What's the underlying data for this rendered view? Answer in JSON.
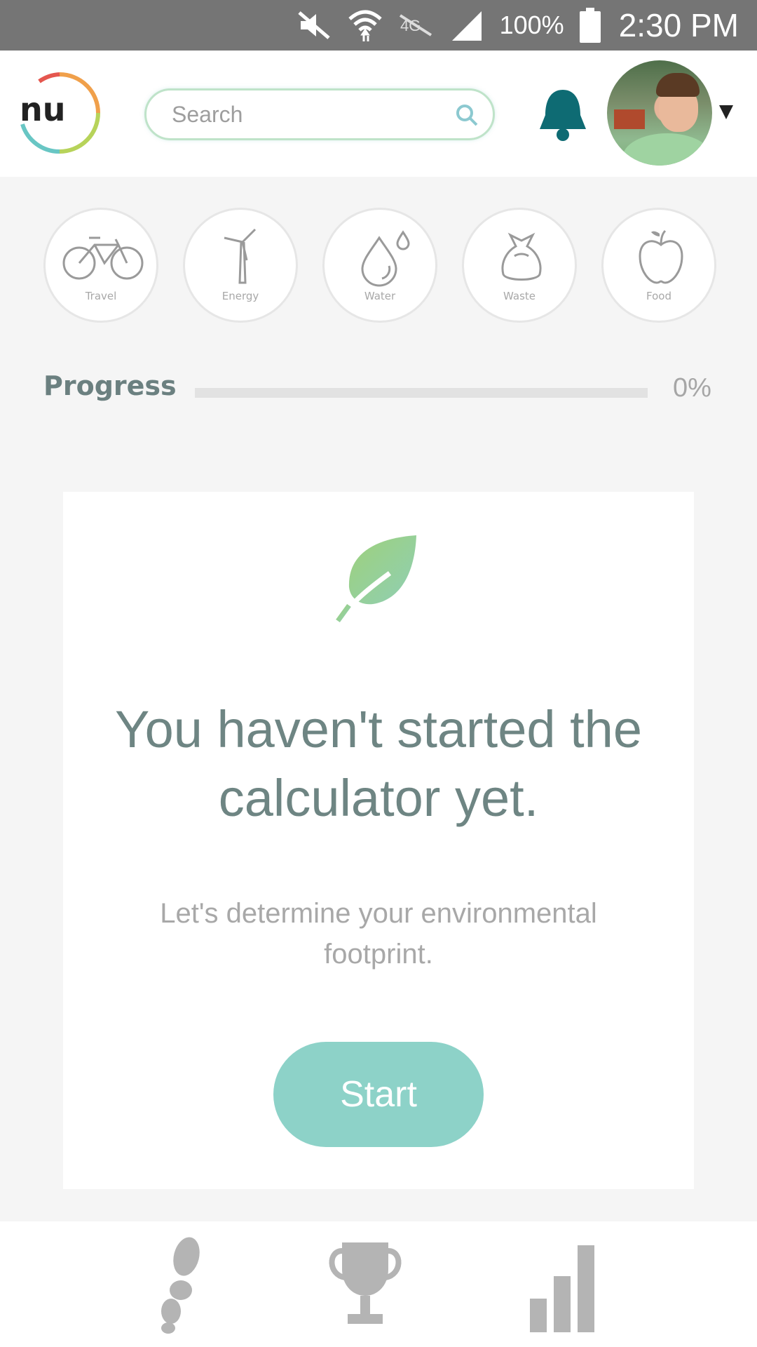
{
  "status_bar": {
    "battery_percent": "100%",
    "time": "2:30 PM",
    "icons": [
      "mute-icon",
      "wifi-icon",
      "lte-off-icon",
      "signal-icon",
      "battery-icon"
    ]
  },
  "header": {
    "logo_text": "nu",
    "search_placeholder": "Search",
    "icons": [
      "search-icon",
      "bell-icon",
      "avatar",
      "caret-down-icon"
    ],
    "accent_bell": "#0e6b73"
  },
  "categories": [
    {
      "label": "Travel",
      "icon": "bicycle-icon"
    },
    {
      "label": "Energy",
      "icon": "wind-turbine-icon"
    },
    {
      "label": "Water",
      "icon": "water-drop-icon"
    },
    {
      "label": "Waste",
      "icon": "trash-bag-icon"
    },
    {
      "label": "Food",
      "icon": "apple-icon"
    }
  ],
  "progress": {
    "label": "Progress",
    "percent_text": "0%",
    "fraction": 0
  },
  "card": {
    "icon": "leaf-icon",
    "title": "You haven't started the calculator yet.",
    "subtitle": "Let's determine your environmental footprint.",
    "button_label": "Start",
    "button_color": "#8dd2c8"
  },
  "bottom_nav": {
    "items": [
      "footprint-icon",
      "trophy-icon",
      "bar-chart-icon"
    ]
  }
}
